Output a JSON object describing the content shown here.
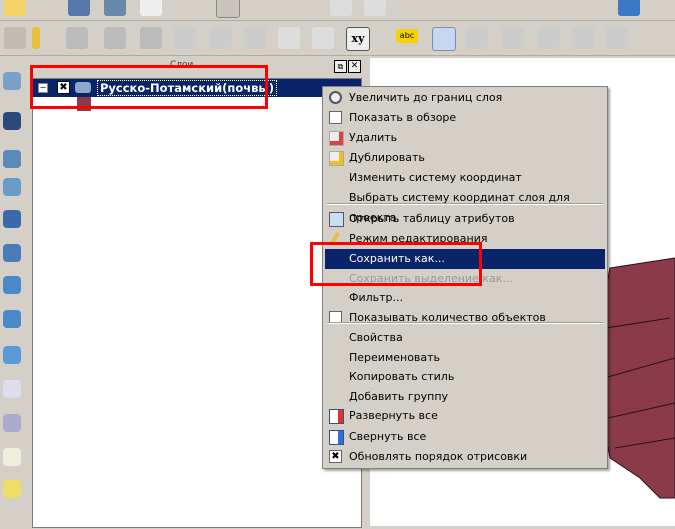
{
  "panel": {
    "title": "Слои"
  },
  "layer": {
    "name": "Русско-Потамский(почвы)",
    "visible": true,
    "color": "#8b3a4a"
  },
  "menu": {
    "items": [
      {
        "label": "Увеличить до границ слоя",
        "icon": "zoom-layer-icon"
      },
      {
        "label": "Показать в обзоре",
        "icon": "checkbox-icon"
      },
      {
        "label": "Удалить",
        "icon": "remove-layer-icon"
      },
      {
        "label": "Дублировать",
        "icon": "duplicate-layer-icon"
      },
      {
        "label": "Изменить систему координат"
      },
      {
        "label": "Выбрать систему координат слоя для проекта"
      },
      {
        "label": "Открыть таблицу атрибутов",
        "icon": "attribute-table-icon"
      },
      {
        "label": "Режим редактирования",
        "icon": "pencil-icon"
      },
      {
        "label": "Сохранить как...",
        "highlighted": true
      },
      {
        "label": "Сохранить выделение как...",
        "disabled": true
      },
      {
        "label": "Фильтр..."
      },
      {
        "label": "Показывать количество объектов",
        "icon": "checkbox-icon"
      },
      {
        "label": "Свойства"
      },
      {
        "label": "Переименовать"
      },
      {
        "label": "Копировать стиль"
      },
      {
        "label": "Добавить группу"
      },
      {
        "label": "Развернуть все",
        "icon": "expand-all-icon"
      },
      {
        "label": "Свернуть все",
        "icon": "collapse-all-icon"
      },
      {
        "label": "Обновлять порядок отрисовки",
        "icon": "checked-checkbox-icon"
      }
    ]
  },
  "toolbar2": {
    "xy_label": "xy",
    "abc_label": "abc"
  },
  "colors": {
    "highlight": "#0a246a",
    "annotation": "#ff0000",
    "polygon": "#8b3a4a"
  }
}
